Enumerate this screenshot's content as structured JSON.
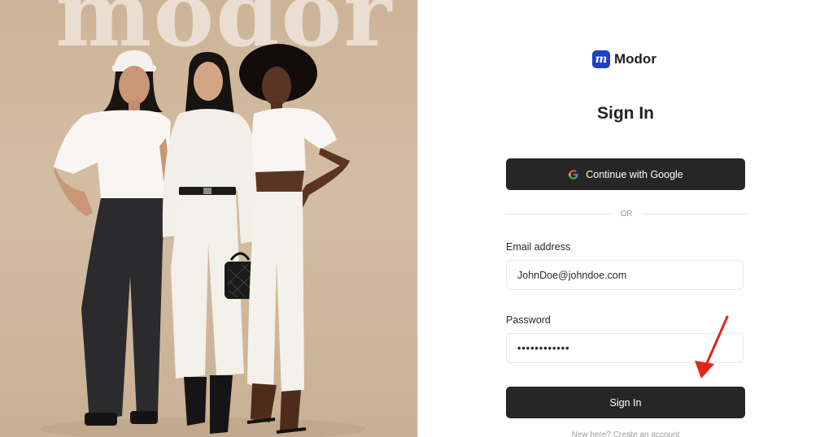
{
  "hero": {
    "brand_word": "modor",
    "background": "#cfb79c"
  },
  "auth": {
    "logo": {
      "mark": "m",
      "name": "Modor",
      "color": "#1d40c8"
    },
    "title": "Sign In",
    "google_button": {
      "label": "Continue with Google",
      "icon": "google-icon"
    },
    "divider_text": "OR",
    "email": {
      "label": "Email address",
      "value": "JohnDoe@johndoe.com"
    },
    "password": {
      "label": "Password",
      "value": "••••••••••••"
    },
    "signin_button": {
      "label": "Sign In"
    },
    "footer_text": "New here? Create an account",
    "annotation": {
      "icon": "arrow-icon",
      "color": "#e3241b"
    }
  }
}
